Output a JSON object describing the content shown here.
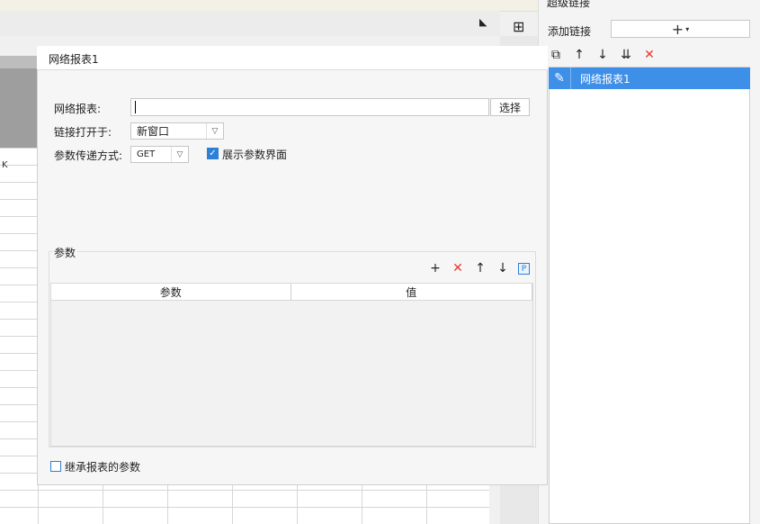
{
  "right_panel": {
    "title": "超级链接",
    "add_link_label": "添加链接",
    "add_button_symbol": "+",
    "add_button_caret": "▾",
    "toolbar": {
      "copy": "⧉",
      "up": "↑",
      "down": "↓",
      "sort": "⇊",
      "delete": "✕"
    },
    "links": [
      {
        "label": "网络报表1",
        "icon": "pencil-icon",
        "selected": true
      }
    ]
  },
  "dialog": {
    "title": "网络报表1",
    "report_label": "网络报表:",
    "report_value": "",
    "select_button": "选择",
    "open_in_label": "链接打开于:",
    "open_in_value": "新窗口",
    "method_label": "参数传递方式:",
    "method_value": "GET",
    "show_params_label": "展示参数界面",
    "show_params_checked": true,
    "params": {
      "group_title": "参数",
      "toolbar": {
        "add": "+",
        "delete": "✕",
        "up": "↑",
        "down": "↓",
        "param": "P"
      },
      "columns": [
        "参数",
        "值"
      ],
      "rows": []
    },
    "inherit_label": "继承报表的参数",
    "inherit_checked": false
  },
  "sheet": {
    "column_label": "K"
  },
  "colors": {
    "accent": "#3e8fe8",
    "delete_red": "#e53935",
    "checkbox_blue": "#2e7fd6"
  }
}
